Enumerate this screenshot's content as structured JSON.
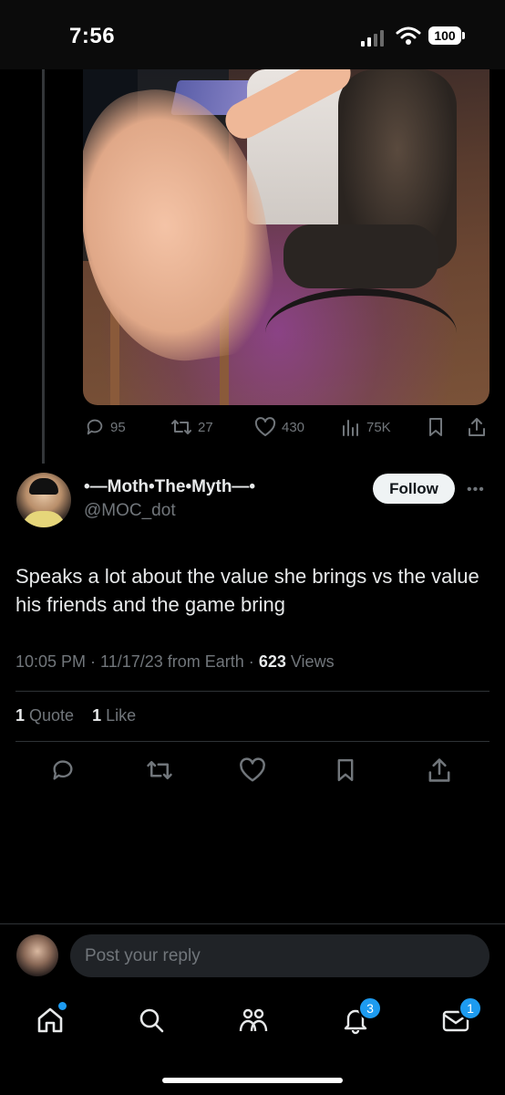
{
  "status_bar": {
    "time": "7:56",
    "battery": "100"
  },
  "quoted_post": {
    "image_icon": "photo",
    "engagement": {
      "replies": "95",
      "reposts": "27",
      "likes": "430",
      "views": "75K"
    }
  },
  "post": {
    "display_name": "•—Moth•The•Myth—•",
    "handle": "@MOC_dot",
    "follow_label": "Follow",
    "more_icon": "more-horizontal-icon",
    "text": "Speaks a lot about the value she brings vs the value his friends and the game bring",
    "meta": {
      "time_date": "10:05 PM · 11/17/23 from Earth ·",
      "views_count": "623",
      "views_label": "Views"
    },
    "stats": {
      "quote_count": "1",
      "quote_label": "Quote",
      "like_count": "1",
      "like_label": "Like"
    }
  },
  "reply": {
    "placeholder": "Post your reply"
  },
  "tab_bar": {
    "notifications_badge": "3",
    "messages_badge": "1"
  },
  "colors": {
    "accent": "#1d9bf0",
    "muted": "#71767b",
    "text": "#e7e9ea",
    "background": "#000000"
  }
}
